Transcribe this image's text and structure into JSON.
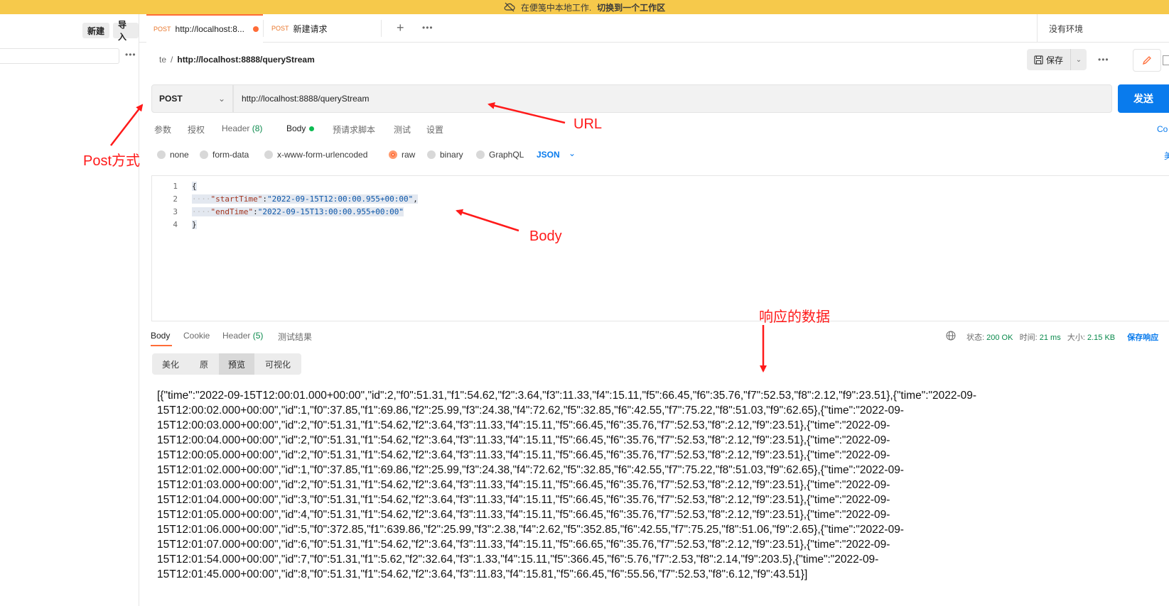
{
  "banner": {
    "text": "在便笺中本地工作.",
    "link": "切换到一个工作区"
  },
  "sidebar": {
    "new_label": "新建",
    "import_label": "导入"
  },
  "tabs": [
    {
      "method": "POST",
      "label": "http://localhost:8...",
      "unsaved": true
    },
    {
      "method": "POST",
      "label": "新建请求",
      "unsaved": false
    }
  ],
  "environment": "没有环境",
  "breadcrumb": {
    "parent": "te",
    "separator": "/",
    "current": "http://localhost:8888/queryStream"
  },
  "toolbar": {
    "save_label": "保存"
  },
  "request": {
    "method": "POST",
    "url": "http://localhost:8888/queryStream",
    "send_label": "发送",
    "tabs": {
      "params": "参数",
      "auth": "授权",
      "headers": "Header",
      "headers_count": "(8)",
      "body": "Body",
      "prerequest": "预请求脚本",
      "tests": "测试",
      "settings": "设置"
    },
    "cookies_link": "Co",
    "body_types": [
      "none",
      "form-data",
      "x-www-form-urlencoded",
      "raw",
      "binary",
      "GraphQL"
    ],
    "body_type_selected": "raw",
    "raw_format": "JSON",
    "beautify_link": "美",
    "body_lines": [
      {
        "n": "1",
        "text": "{"
      },
      {
        "n": "2",
        "key": "\"startTime\"",
        "value": "\"2022-09-15T12:00:00.955+00:00\"",
        "trail": ","
      },
      {
        "n": "3",
        "key": "\"endTime\"",
        "value": "\"2022-09-15T13:00:00.955+00:00\"",
        "trail": ""
      },
      {
        "n": "4",
        "text": "}"
      }
    ]
  },
  "response": {
    "tabs": {
      "body": "Body",
      "cookies": "Cookie",
      "headers": "Header",
      "headers_count": "(5)",
      "test_results": "测试结果"
    },
    "status_label": "状态:",
    "status_value": "200 OK",
    "time_label": "时间:",
    "time_value": "21 ms",
    "size_label": "大小:",
    "size_value": "2.15 KB",
    "save_response": "保存响应",
    "views": [
      "美化",
      "原",
      "预览",
      "可视化"
    ],
    "active_view": "预览",
    "body_lines": [
      "[{\"time\":\"2022-09-15T12:00:01.000+00:00\",\"id\":2,\"f0\":51.31,\"f1\":54.62,\"f2\":3.64,\"f3\":11.33,\"f4\":15.11,\"f5\":66.45,\"f6\":35.76,\"f7\":52.53,\"f8\":2.12,\"f9\":23.51},{\"time\":\"2022-09-",
      "15T12:00:02.000+00:00\",\"id\":1,\"f0\":37.85,\"f1\":69.86,\"f2\":25.99,\"f3\":24.38,\"f4\":72.62,\"f5\":32.85,\"f6\":42.55,\"f7\":75.22,\"f8\":51.03,\"f9\":62.65},{\"time\":\"2022-09-",
      "15T12:00:03.000+00:00\",\"id\":2,\"f0\":51.31,\"f1\":54.62,\"f2\":3.64,\"f3\":11.33,\"f4\":15.11,\"f5\":66.45,\"f6\":35.76,\"f7\":52.53,\"f8\":2.12,\"f9\":23.51},{\"time\":\"2022-09-",
      "15T12:00:04.000+00:00\",\"id\":2,\"f0\":51.31,\"f1\":54.62,\"f2\":3.64,\"f3\":11.33,\"f4\":15.11,\"f5\":66.45,\"f6\":35.76,\"f7\":52.53,\"f8\":2.12,\"f9\":23.51},{\"time\":\"2022-09-",
      "15T12:00:05.000+00:00\",\"id\":2,\"f0\":51.31,\"f1\":54.62,\"f2\":3.64,\"f3\":11.33,\"f4\":15.11,\"f5\":66.45,\"f6\":35.76,\"f7\":52.53,\"f8\":2.12,\"f9\":23.51},{\"time\":\"2022-09-",
      "15T12:01:02.000+00:00\",\"id\":1,\"f0\":37.85,\"f1\":69.86,\"f2\":25.99,\"f3\":24.38,\"f4\":72.62,\"f5\":32.85,\"f6\":42.55,\"f7\":75.22,\"f8\":51.03,\"f9\":62.65},{\"time\":\"2022-09-",
      "15T12:01:03.000+00:00\",\"id\":2,\"f0\":51.31,\"f1\":54.62,\"f2\":3.64,\"f3\":11.33,\"f4\":15.11,\"f5\":66.45,\"f6\":35.76,\"f7\":52.53,\"f8\":2.12,\"f9\":23.51},{\"time\":\"2022-09-",
      "15T12:01:04.000+00:00\",\"id\":3,\"f0\":51.31,\"f1\":54.62,\"f2\":3.64,\"f3\":11.33,\"f4\":15.11,\"f5\":66.45,\"f6\":35.76,\"f7\":52.53,\"f8\":2.12,\"f9\":23.51},{\"time\":\"2022-09-",
      "15T12:01:05.000+00:00\",\"id\":4,\"f0\":51.31,\"f1\":54.62,\"f2\":3.64,\"f3\":11.33,\"f4\":15.11,\"f5\":66.45,\"f6\":35.76,\"f7\":52.53,\"f8\":2.12,\"f9\":23.51},{\"time\":\"2022-09-",
      "15T12:01:06.000+00:00\",\"id\":5,\"f0\":372.85,\"f1\":639.86,\"f2\":25.99,\"f3\":2.38,\"f4\":2.62,\"f5\":352.85,\"f6\":42.55,\"f7\":75.25,\"f8\":51.06,\"f9\":2.65},{\"time\":\"2022-09-",
      "15T12:01:07.000+00:00\",\"id\":6,\"f0\":51.31,\"f1\":54.62,\"f2\":3.64,\"f3\":11.33,\"f4\":15.11,\"f5\":66.65,\"f6\":35.76,\"f7\":52.53,\"f8\":2.12,\"f9\":23.51},{\"time\":\"2022-09-",
      "15T12:01:54.000+00:00\",\"id\":7,\"f0\":51.31,\"f1\":5.62,\"f2\":32.64,\"f3\":1.33,\"f4\":15.11,\"f5\":366.45,\"f6\":5.76,\"f7\":2.53,\"f8\":2.14,\"f9\":203.5},{\"time\":\"2022-09-",
      "15T12:01:45.000+00:00\",\"id\":8,\"f0\":51.31,\"f1\":54.62,\"f2\":3.64,\"f3\":11.83,\"f4\":15.81,\"f5\":66.45,\"f6\":55.56,\"f7\":52.53,\"f8\":6.12,\"f9\":43.51}]"
    ]
  },
  "annotations": {
    "post": "Post方式",
    "url": "URL",
    "body": "Body",
    "response": "响应的数据"
  },
  "colors": {
    "banner": "#f6c94b",
    "accent": "#ff6c37",
    "send": "#097bed",
    "annotation": "#ff1a1a",
    "status_ok": "#0a8a4c"
  }
}
